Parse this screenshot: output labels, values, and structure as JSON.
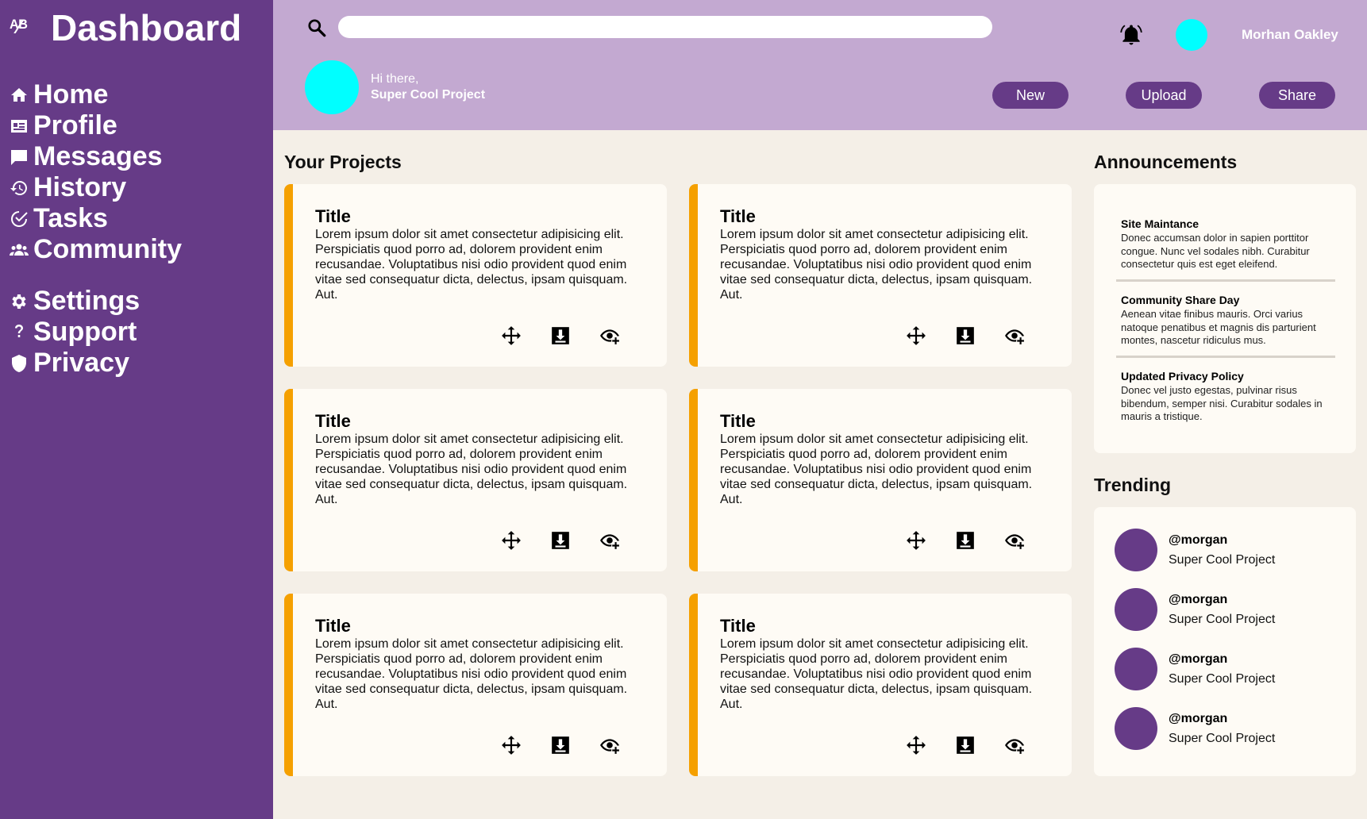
{
  "sidebar": {
    "brand_icon": "ᴬ⁄ᴮ",
    "title": "Dashboard",
    "primary": [
      {
        "label": "Home",
        "icon": "home-icon"
      },
      {
        "label": "Profile",
        "icon": "id-card-icon"
      },
      {
        "label": "Messages",
        "icon": "chat-icon"
      },
      {
        "label": "History",
        "icon": "history-icon"
      },
      {
        "label": "Tasks",
        "icon": "check-icon"
      },
      {
        "label": "Community",
        "icon": "group-icon"
      }
    ],
    "secondary": [
      {
        "label": "Settings",
        "icon": "gear-icon"
      },
      {
        "label": "Support",
        "icon": "question-icon"
      },
      {
        "label": "Privacy",
        "icon": "shield-icon"
      }
    ]
  },
  "header": {
    "search": {
      "value": "",
      "placeholder": ""
    },
    "username": "Morhan Oakley",
    "greeting": "Hi there,",
    "project": "Super Cool Project",
    "buttons": {
      "new": "New",
      "upload": "Upload",
      "share": "Share"
    }
  },
  "projects": {
    "heading": "Your Projects",
    "cards": [
      {
        "title": "Title",
        "body": "Lorem ipsum dolor sit amet consectetur adipisicing elit. Perspiciatis quod porro ad, dolorem provident enim recusandae. Voluptatibus nisi odio provident quod enim vitae sed consequatur dicta, delectus, ipsam quisquam. Aut."
      },
      {
        "title": "Title",
        "body": "Lorem ipsum dolor sit amet consectetur adipisicing elit. Perspiciatis quod porro ad, dolorem provident enim recusandae. Voluptatibus nisi odio provident quod enim vitae sed consequatur dicta, delectus, ipsam quisquam. Aut."
      },
      {
        "title": "Title",
        "body": "Lorem ipsum dolor sit amet consectetur adipisicing elit. Perspiciatis quod porro ad, dolorem provident enim recusandae. Voluptatibus nisi odio provident quod enim vitae sed consequatur dicta, delectus, ipsam quisquam. Aut."
      },
      {
        "title": "Title",
        "body": "Lorem ipsum dolor sit amet consectetur adipisicing elit. Perspiciatis quod porro ad, dolorem provident enim recusandae. Voluptatibus nisi odio provident quod enim vitae sed consequatur dicta, delectus, ipsam quisquam. Aut."
      },
      {
        "title": "Title",
        "body": "Lorem ipsum dolor sit amet consectetur adipisicing elit. Perspiciatis quod porro ad, dolorem provident enim recusandae. Voluptatibus nisi odio provident quod enim vitae sed consequatur dicta, delectus, ipsam quisquam. Aut."
      },
      {
        "title": "Title",
        "body": "Lorem ipsum dolor sit amet consectetur adipisicing elit. Perspiciatis quod porro ad, dolorem provident enim recusandae. Voluptatibus nisi odio provident quod enim vitae sed consequatur dicta, delectus, ipsam quisquam. Aut."
      }
    ],
    "action_icons": [
      "move-icon",
      "download-icon",
      "watch-icon"
    ]
  },
  "announcements": {
    "heading": "Announcements",
    "items": [
      {
        "title": "Site Maintance",
        "body": "Donec accumsan dolor in sapien porttitor congue. Nunc vel sodales nibh. Curabitur consectetur quis est eget eleifend."
      },
      {
        "title": "Community Share Day",
        "body": "Aenean vitae finibus mauris. Orci varius natoque penatibus et magnis dis parturient montes, nascetur ridiculus mus."
      },
      {
        "title": "Updated Privacy Policy",
        "body": "Donec vel justo egestas, pulvinar risus bibendum, semper nisi. Curabitur sodales in mauris a tristique."
      }
    ]
  },
  "trending": {
    "heading": "Trending",
    "items": [
      {
        "handle": "@morgan",
        "project": "Super Cool Project"
      },
      {
        "handle": "@morgan",
        "project": "Super Cool Project"
      },
      {
        "handle": "@morgan",
        "project": "Super Cool Project"
      },
      {
        "handle": "@morgan",
        "project": "Super Cool Project"
      }
    ]
  },
  "colors": {
    "sidebar": "#663b87",
    "header": "#c3a9d1",
    "accent": "#f5a000",
    "avatar": "#00ffff",
    "background": "#f4efe7",
    "card": "#fefbf5"
  }
}
